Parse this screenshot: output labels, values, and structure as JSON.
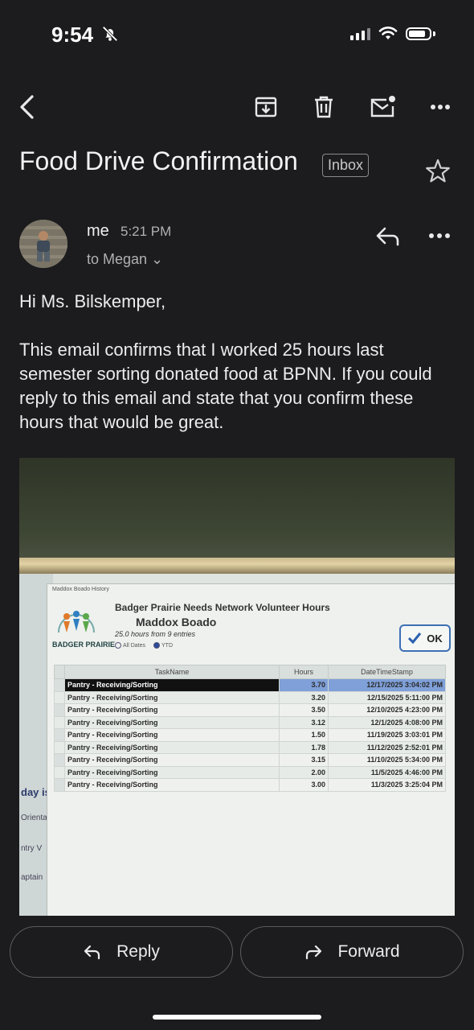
{
  "status": {
    "time": "9:54",
    "icons": [
      "bell-slash-icon",
      "signal-icon",
      "wifi-icon",
      "battery-icon"
    ]
  },
  "toolbar": {
    "icons": [
      "back-arrow-icon",
      "archive-icon",
      "trash-icon",
      "mark-unread-icon",
      "more-dots-icon"
    ]
  },
  "email": {
    "subject": "Food Drive Confirmation",
    "label": "Inbox",
    "sender": "me",
    "time": "5:21 PM",
    "recipients": "to Megan ⌄",
    "greeting": "Hi Ms. Bilskemper,",
    "body": "This email confirms that I worked 25 hours last semester sorting donated food at BPNN. If you could reply to this email and state that you confirm these hours that would be great."
  },
  "attachment": {
    "window_title": "Maddox Boado History",
    "logo_text": "BADGER PRAIRIE",
    "heading": "Badger Prairie Needs Network Volunteer Hours",
    "name": "Maddox Boado",
    "summary": "25.0 hours from 9 entries",
    "radio_all": "All Dates",
    "radio_ytd": "YTD",
    "ok_label": "OK",
    "columns": [
      "TaskName",
      "Hours",
      "DateTimeStamp"
    ],
    "rows": [
      {
        "task": "Pantry - Receiving/Sorting",
        "hours": "3.70",
        "date": "12/17/2025 3:04:02 PM"
      },
      {
        "task": "Pantry - Receiving/Sorting",
        "hours": "3.20",
        "date": "12/15/2025 5:11:00 PM"
      },
      {
        "task": "Pantry - Receiving/Sorting",
        "hours": "3.50",
        "date": "12/10/2025 4:23:00 PM"
      },
      {
        "task": "Pantry - Receiving/Sorting",
        "hours": "3.12",
        "date": "12/1/2025 4:08:00 PM"
      },
      {
        "task": "Pantry - Receiving/Sorting",
        "hours": "1.50",
        "date": "11/19/2025 3:03:01 PM"
      },
      {
        "task": "Pantry - Receiving/Sorting",
        "hours": "1.78",
        "date": "11/12/2025 2:52:01 PM"
      },
      {
        "task": "Pantry - Receiving/Sorting",
        "hours": "3.15",
        "date": "11/10/2025 5:34:00 PM"
      },
      {
        "task": "Pantry - Receiving/Sorting",
        "hours": "2.00",
        "date": "11/5/2025 4:46:00 PM"
      },
      {
        "task": "Pantry - Receiving/Sorting",
        "hours": "3.00",
        "date": "11/3/2025 3:25:04 PM"
      }
    ],
    "bg_fragments": [
      "day is",
      "Orienta",
      "ntry V",
      "aptain"
    ]
  },
  "actions": {
    "reply": "Reply",
    "forward": "Forward"
  }
}
